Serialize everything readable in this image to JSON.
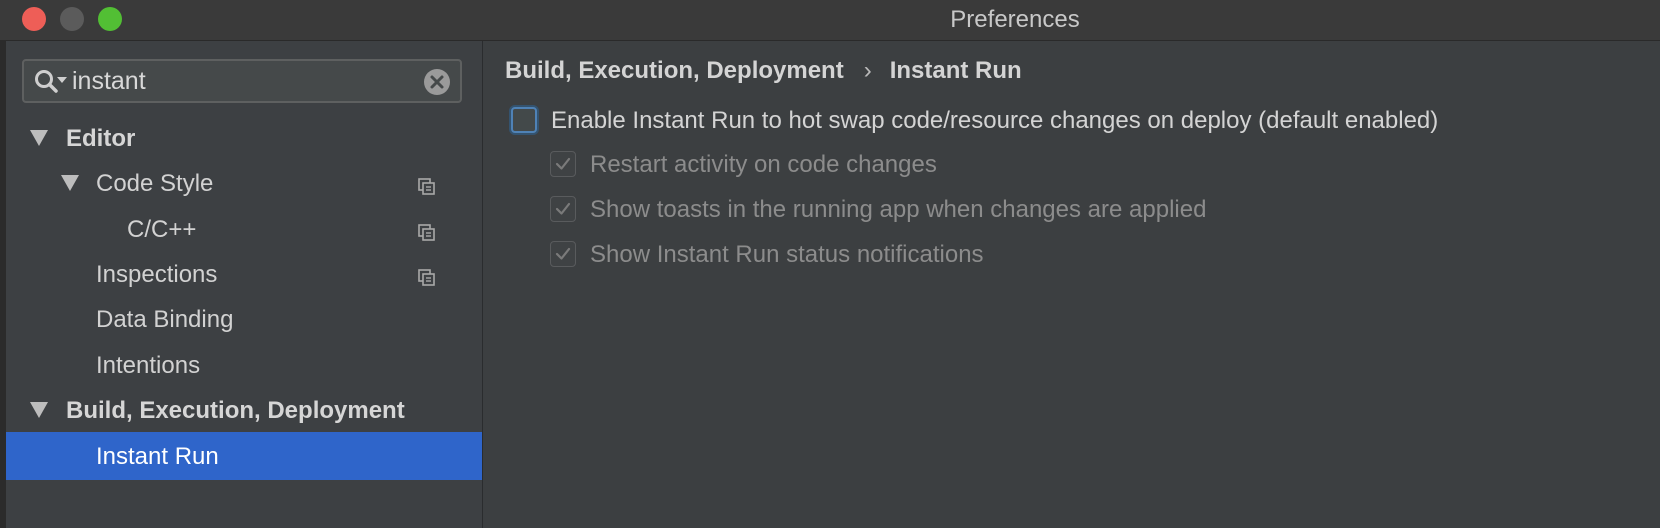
{
  "window": {
    "title": "Preferences"
  },
  "search": {
    "value": "instant",
    "icon": "search-icon"
  },
  "sidebar": {
    "items": [
      {
        "label": "Editor",
        "level": 0,
        "expanded": true,
        "bold": true,
        "copy_icon": false
      },
      {
        "label": "Code Style",
        "level": 1,
        "expanded": true,
        "bold": false,
        "copy_icon": true
      },
      {
        "label": "C/C++",
        "level": 2,
        "bold": false,
        "copy_icon": true
      },
      {
        "label": "Inspections",
        "level": 1,
        "bold": false,
        "copy_icon": true
      },
      {
        "label": "Data Binding",
        "level": 1,
        "bold": false,
        "copy_icon": false
      },
      {
        "label": "Intentions",
        "level": 1,
        "bold": false,
        "copy_icon": false
      },
      {
        "label": "Build, Execution, Deployment",
        "level": 0,
        "expanded": true,
        "bold": true,
        "copy_icon": false
      },
      {
        "label": "Instant Run",
        "level": 1,
        "bold": false,
        "copy_icon": false,
        "selected": true
      }
    ]
  },
  "breadcrumb": {
    "parent": "Build, Execution, Deployment",
    "separator": "›",
    "current": "Instant Run"
  },
  "options": {
    "main": {
      "label": "Enable Instant Run to hot swap code/resource changes on deploy (default enabled)",
      "checked": false
    },
    "restart": {
      "label": "Restart activity on code changes",
      "checked": true,
      "disabled": true
    },
    "toasts": {
      "label": "Show toasts in the running app when changes are applied",
      "checked": true,
      "disabled": true
    },
    "status": {
      "label": "Show Instant Run status notifications",
      "checked": true,
      "disabled": true
    }
  },
  "colors": {
    "selection": "#2f65ca",
    "accent_focus": "#4f82b6",
    "close": "#ee5e57",
    "maximize": "#52bf34"
  }
}
